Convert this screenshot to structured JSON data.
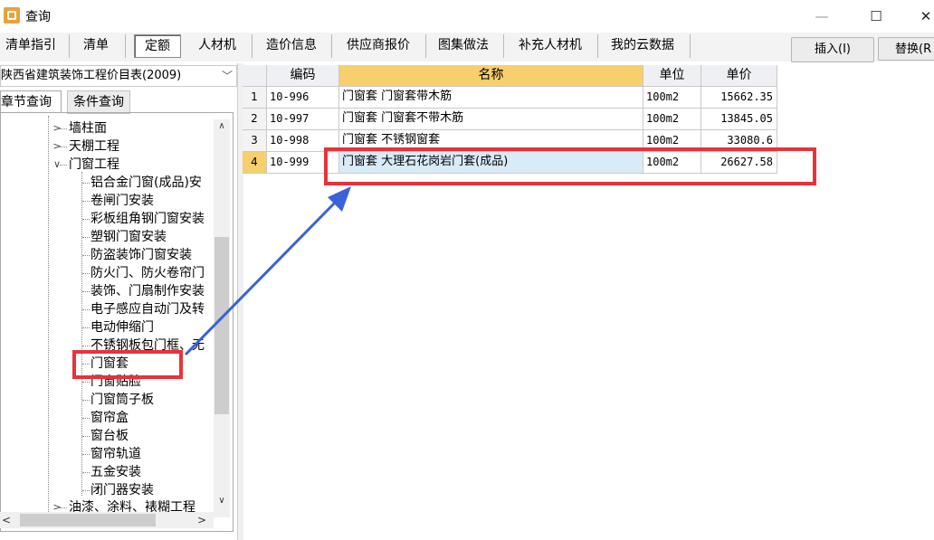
{
  "window": {
    "title": "查询",
    "minimize": "—",
    "maximize": "☐",
    "close": "✕"
  },
  "tabs": [
    "清单指引",
    "清单",
    "定额",
    "人材机",
    "造价信息",
    "供应商报价",
    "图集做法",
    "补充人材机",
    "我的云数据"
  ],
  "actions": {
    "insert": "插入(I)",
    "replace": "替换(R"
  },
  "left": {
    "catalog": "陕西省建筑装饰工程价目表(2009)",
    "dropdown_arrow": "﹀",
    "subtabs": [
      "章节查询",
      "条件查询"
    ],
    "tree": [
      {
        "label": "墙柱面",
        "expander": ">"
      },
      {
        "label": "天棚工程",
        "expander": ">"
      },
      {
        "label": "门窗工程",
        "expander": "∨"
      },
      {
        "label": "铝合金门窗(成品)安"
      },
      {
        "label": "卷闸门安装"
      },
      {
        "label": "彩板组角钢门窗安装"
      },
      {
        "label": "塑钢门窗安装"
      },
      {
        "label": "防盗装饰门窗安装"
      },
      {
        "label": "防火门、防火卷帘门"
      },
      {
        "label": "装饰、门扇制作安装"
      },
      {
        "label": "电子感应自动门及转"
      },
      {
        "label": "电动伸缩门"
      },
      {
        "label": "不锈钢板包门框、无"
      },
      {
        "label": "门窗套"
      },
      {
        "label": "门窗贴脸"
      },
      {
        "label": "门窗筒子板"
      },
      {
        "label": "窗帘盒"
      },
      {
        "label": "窗台板"
      },
      {
        "label": "窗帘轨道"
      },
      {
        "label": "五金安装"
      },
      {
        "label": "闭门器安装"
      },
      {
        "label": "油漆、涂料、裱糊工程",
        "expander": ">"
      }
    ],
    "scroll": {
      "up": "∧",
      "down": "∨",
      "left": "<",
      "right": ">"
    }
  },
  "grid": {
    "headers": [
      "编码",
      "名称",
      "单位",
      "单价"
    ],
    "rows": [
      {
        "num": "1",
        "code": "10-996",
        "name": "门窗套 门窗套带木筋",
        "unit": "100m2",
        "price": "15662.35"
      },
      {
        "num": "2",
        "code": "10-997",
        "name": "门窗套 门窗套不带木筋",
        "unit": "100m2",
        "price": "13845.05"
      },
      {
        "num": "3",
        "code": "10-998",
        "name": "门窗套 不锈钢窗套",
        "unit": "100m2",
        "price": "33080.6"
      },
      {
        "num": "4",
        "code": "10-999",
        "name": "门窗套 大理石花岗岩门套(成品)",
        "unit": "100m2",
        "price": "26627.58"
      }
    ]
  },
  "annotation": {
    "arrow_color": "#3a62d8",
    "box_color": "#e8323a"
  }
}
